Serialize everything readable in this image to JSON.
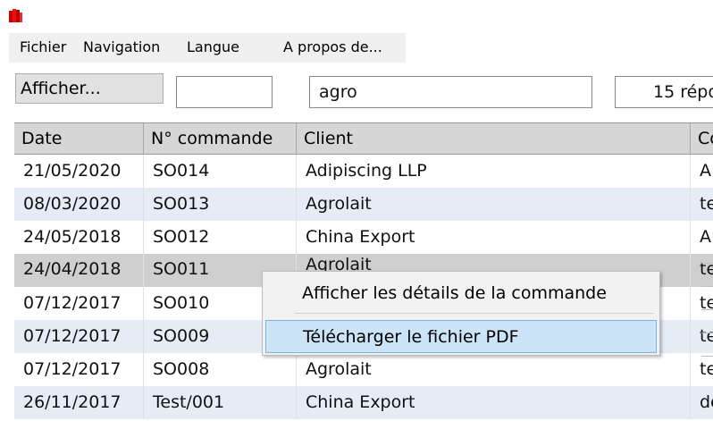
{
  "menu": {
    "file": "Fichier",
    "navigation": "Navigation",
    "language": "Langue",
    "about": "A propos de..."
  },
  "toolbar": {
    "show_button": "Afficher...",
    "field1_value": "",
    "search_value": "agro",
    "results_text": "15 répo"
  },
  "table": {
    "headers": [
      "Date",
      "N° commande",
      "Client",
      "Co"
    ],
    "rows": [
      [
        "21/05/2020",
        "SO014",
        "Adipiscing LLP",
        "A"
      ],
      [
        "08/03/2020",
        "SO013",
        "Agrolait",
        "te"
      ],
      [
        "24/05/2018",
        "SO012",
        "China Export",
        "A"
      ],
      [
        "24/04/2018",
        "SO011",
        "Agrolait",
        "te"
      ],
      [
        "07/12/2017",
        "SO010",
        "",
        "te"
      ],
      [
        "07/12/2017",
        "SO009",
        "",
        "te"
      ],
      [
        "07/12/2017",
        "SO008",
        "Agrolait",
        "te"
      ],
      [
        "26/11/2017",
        "Test/001",
        "China Export",
        "de"
      ]
    ],
    "selected_row": 3
  },
  "context_menu": {
    "items": [
      "Afficher les détails de la commande",
      "Télécharger le fichier PDF"
    ],
    "hovered": 1
  },
  "colors": {
    "row_alt": "#e6ecf5",
    "row_selected": "#cfcfcf",
    "header_bg": "#d6d6d6",
    "hover_bg": "#cce4f7"
  }
}
